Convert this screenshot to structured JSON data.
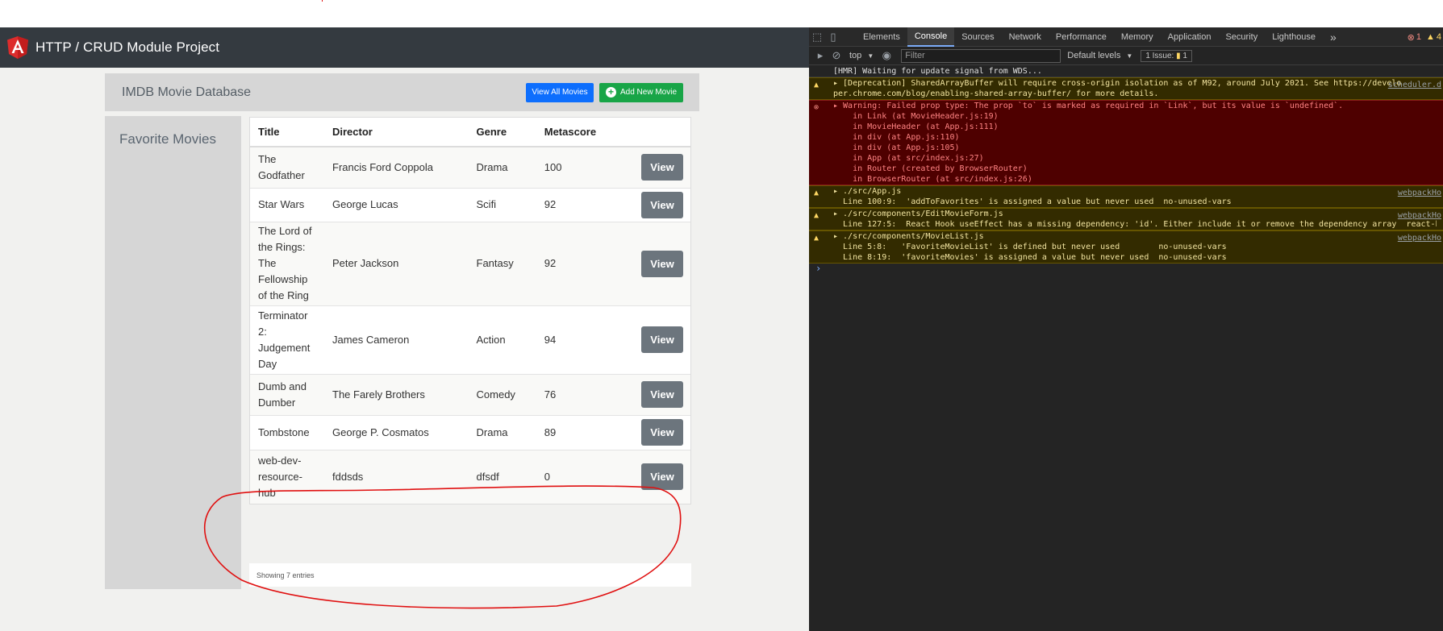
{
  "browser": {
    "top_strip_color": "#ffffff"
  },
  "navbar": {
    "brand": "HTTP / CRUD Module Project",
    "logo_icon": "angular-shield-icon"
  },
  "header": {
    "title": "IMDB Movie Database",
    "view_all_label": "View All Movies",
    "add_new_label": "Add New Movie"
  },
  "sidebar": {
    "title": "Favorite Movies"
  },
  "table": {
    "columns": [
      "Title",
      "Director",
      "Genre",
      "Metascore",
      ""
    ],
    "rows": [
      {
        "title": "The Godfather",
        "director": "Francis Ford Coppola",
        "genre": "Drama",
        "metascore": "100",
        "action": "View"
      },
      {
        "title": "Star Wars",
        "director": "George Lucas",
        "genre": "Scifi",
        "metascore": "92",
        "action": "View"
      },
      {
        "title": "The Lord of the Rings: The Fellowship of the Ring",
        "director": "Peter Jackson",
        "genre": "Fantasy",
        "metascore": "92",
        "action": "View"
      },
      {
        "title": "Terminator 2: Judgement Day",
        "director": "James Cameron",
        "genre": "Action",
        "metascore": "94",
        "action": "View"
      },
      {
        "title": "Dumb and Dumber",
        "director": "The Farely Brothers",
        "genre": "Comedy",
        "metascore": "76",
        "action": "View"
      },
      {
        "title": "Tombstone",
        "director": "George P. Cosmatos",
        "genre": "Drama",
        "metascore": "89",
        "action": "View"
      },
      {
        "title": "web-dev-resource-hub",
        "director": "fddsds",
        "genre": "dfsdf",
        "metascore": "0",
        "action": "View"
      }
    ],
    "footer": "Showing 7 entries"
  },
  "devtools": {
    "tabs": [
      "Elements",
      "Console",
      "Sources",
      "Network",
      "Performance",
      "Memory",
      "Application",
      "Security",
      "Lighthouse"
    ],
    "active_tab": "Console",
    "more_tabs": "»",
    "error_count": "1",
    "warning_count": "4",
    "context": "top",
    "filter_placeholder": "Filter",
    "levels": "Default levels",
    "issues": "1 Issue: ",
    "issues_count": "1",
    "messages": [
      {
        "type": "info",
        "lines": [
          "[HMR] Waiting for update signal from WDS..."
        ],
        "source": ""
      },
      {
        "type": "warn",
        "lines": [
          "▸ [Deprecation] SharedArrayBuffer will require cross-origin isolation as of M92, around July 2021. See https://develo",
          "per.chrome.com/blog/enabling-shared-array-buffer/ for more details."
        ],
        "source": "scheduler.d"
      },
      {
        "type": "err",
        "lines": [
          "▸ Warning: Failed prop type: The prop `to` is marked as required in `Link`, but its value is `undefined`.",
          "    in Link (at MovieHeader.js:19)",
          "    in MovieHeader (at App.js:111)",
          "    in div (at App.js:110)",
          "    in div (at App.js:105)",
          "    in App (at src/index.js:27)",
          "    in Router (created by BrowserRouter)",
          "    in BrowserRouter (at src/index.js:26)"
        ],
        "source": ""
      },
      {
        "type": "warn",
        "lines": [
          "▸ ./src/App.js",
          "  Line 100:9:  'addToFavorites' is assigned a value but never used  no-unused-vars"
        ],
        "source": "webpackHo"
      },
      {
        "type": "warn",
        "lines": [
          "▸ ./src/components/EditMovieForm.js",
          "  Line 127:5:  React Hook useEffect has a missing dependency: 'id'. Either include it or remove the dependency array  react-hooks"
        ],
        "source": "webpackHo"
      },
      {
        "type": "warn",
        "lines": [
          "▸ ./src/components/MovieList.js",
          "  Line 5:8:   'FavoriteMovieList' is defined but never used        no-unused-vars",
          "  Line 8:19:  'favoriteMovies' is assigned a value but never used  no-unused-vars"
        ],
        "source": "webpackHo"
      }
    ],
    "prompt": "›"
  },
  "colors": {
    "navbar": "#343a40",
    "primary": "#0d6efd",
    "success": "#18a547",
    "view_button": "#6c757d",
    "annotation": "#e01010"
  }
}
